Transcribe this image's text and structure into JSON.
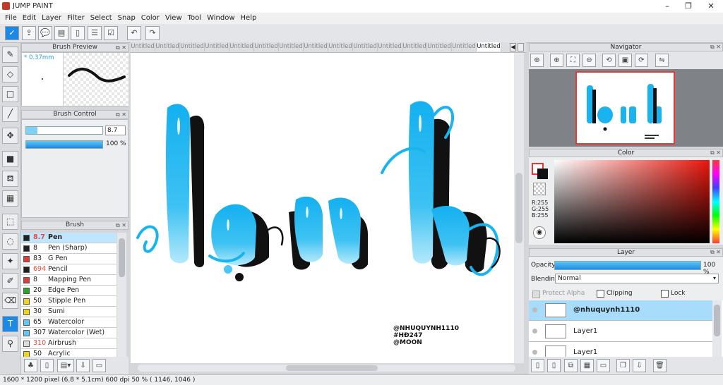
{
  "app": {
    "title": "JUMP PAINT"
  },
  "menu": [
    "File",
    "Edit",
    "Layer",
    "Filter",
    "Select",
    "Snap",
    "Color",
    "View",
    "Tool",
    "Window",
    "Help"
  ],
  "brush_preview": {
    "title": "Brush Preview",
    "size_label": "* 0.37mm"
  },
  "brush_control": {
    "title": "Brush Control",
    "size_value": "8.7",
    "opacity_value": "100 %"
  },
  "brush_list": {
    "title": "Brush",
    "items": [
      {
        "size": "8.7",
        "name": "Pen",
        "color": "#202020",
        "selected": true,
        "size_color": "#e74c3c"
      },
      {
        "size": "8",
        "name": "Pen (Sharp)",
        "color": "#202020",
        "selected": false,
        "size_color": "#222"
      },
      {
        "size": "83",
        "name": "G Pen",
        "color": "#e53935",
        "selected": false,
        "size_color": "#222"
      },
      {
        "size": "694",
        "name": "Pencil",
        "color": "#202020",
        "selected": false,
        "size_color": "#e74c3c"
      },
      {
        "size": "8",
        "name": "Mapping Pen",
        "color": "#e53935",
        "selected": false,
        "size_color": "#222"
      },
      {
        "size": "20",
        "name": "Edge Pen",
        "color": "#2aa52a",
        "selected": false,
        "size_color": "#222"
      },
      {
        "size": "50",
        "name": "Stipple Pen",
        "color": "#f2d21b",
        "selected": false,
        "size_color": "#222"
      },
      {
        "size": "30",
        "name": "Sumi",
        "color": "#f2d21b",
        "selected": false,
        "size_color": "#222"
      },
      {
        "size": "65",
        "name": "Watercolor",
        "color": "#5bc8f5",
        "selected": false,
        "size_color": "#222"
      },
      {
        "size": "307",
        "name": "Watercolor (Wet)",
        "color": "#5bc8f5",
        "selected": false,
        "size_color": "#222"
      },
      {
        "size": "310",
        "name": "Airbrush",
        "color": "#dddddd",
        "selected": false,
        "size_color": "#e74c3c"
      },
      {
        "size": "50",
        "name": "Acrylic",
        "color": "#f2d21b",
        "selected": false,
        "size_color": "#222"
      }
    ]
  },
  "tabs": [
    "Untitled",
    "Untitled",
    "Untitled",
    "Untitled",
    "Untitled",
    "Untitled",
    "Untitled",
    "Untitled",
    "Untitled",
    "Untitled",
    "Untitled",
    "Untitled",
    "Untitled",
    "Untitled",
    "Untitled"
  ],
  "canvas": {
    "watermark_lines": [
      "@NHUQUYNH1110",
      "#HĐ247",
      "@MOON"
    ]
  },
  "navigator": {
    "title": "Navigator"
  },
  "color_panel": {
    "title": "Color",
    "r": "R:255",
    "g": "G:255",
    "b": "B:255"
  },
  "layer_panel": {
    "title": "Layer",
    "opacity_label": "Opacity",
    "opacity_value": "100 %",
    "blending_label": "Blending",
    "blending_value": "Normal",
    "protect_alpha": "Protect Alpha",
    "clipping": "Clipping",
    "lock": "Lock",
    "layers": [
      {
        "name": "@nhuquynh1110",
        "selected": true
      },
      {
        "name": "Layer1",
        "selected": false
      },
      {
        "name": "Layer1",
        "selected": false
      }
    ]
  },
  "status": {
    "text": "1600 * 1200 pixel   (6.8 * 5.1cm)   600 dpi   50 %   ( 1146, 1046 )"
  },
  "colors": {
    "accent": "#1e88e5",
    "stroke_blue": "#19b4f0",
    "selection": "#a7dcfa"
  }
}
